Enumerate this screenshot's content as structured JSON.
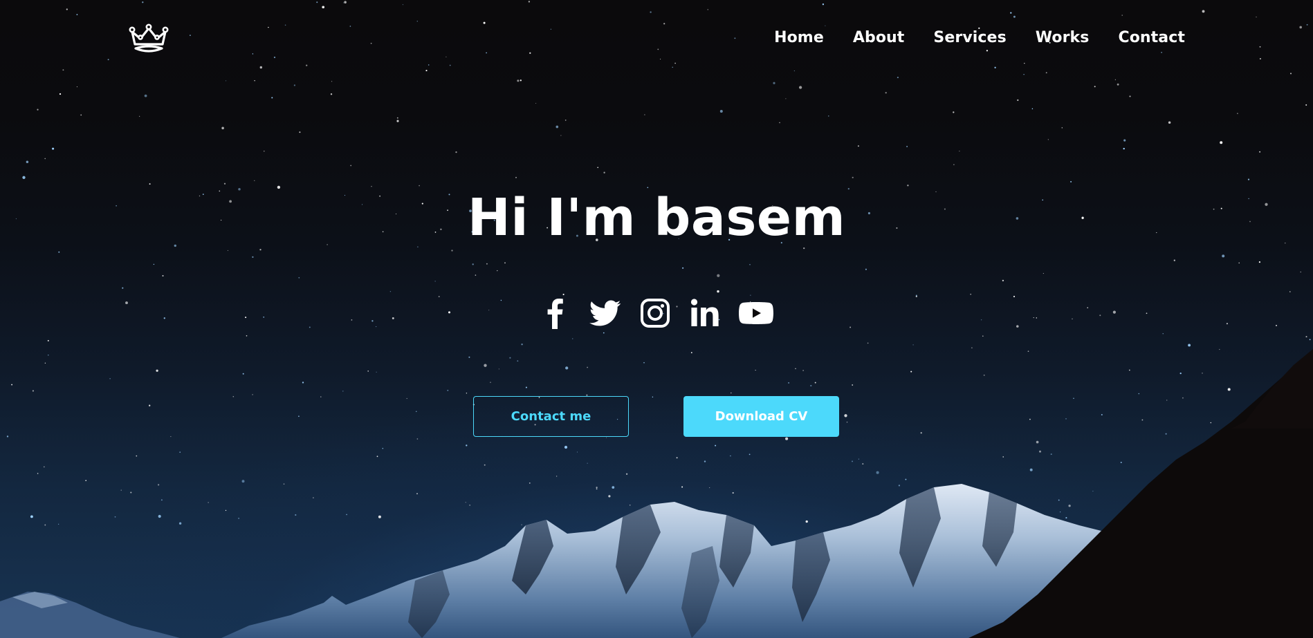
{
  "nav": {
    "logo_icon": "crown-icon",
    "items": [
      {
        "label": "Home"
      },
      {
        "label": "About"
      },
      {
        "label": "Services"
      },
      {
        "label": "Works"
      },
      {
        "label": "Contact"
      }
    ]
  },
  "hero": {
    "title": "Hi I'm basem",
    "socials": [
      {
        "icon": "facebook-icon"
      },
      {
        "icon": "twitter-icon"
      },
      {
        "icon": "instagram-icon"
      },
      {
        "icon": "linkedin-icon"
      },
      {
        "icon": "youtube-icon"
      }
    ],
    "buttons": {
      "contact_label": "Contact me",
      "download_label": "Download CV"
    }
  },
  "colors": {
    "accent": "#4cd9fb",
    "text": "#ffffff",
    "background": "#0b0a0b"
  }
}
